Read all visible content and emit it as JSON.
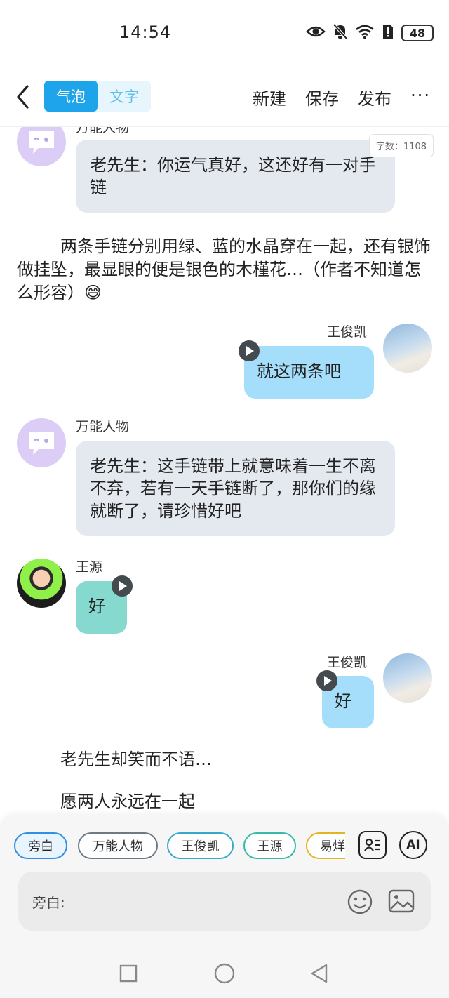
{
  "status": {
    "time": "14:54",
    "battery": "48"
  },
  "nav": {
    "tab_bubble": "气泡",
    "tab_text": "文字",
    "new_label": "新建",
    "save_label": "保存",
    "publish_label": "发布",
    "more": "···"
  },
  "chat": {
    "word_count": "字数：1108",
    "messages": [
      {
        "type": "bubble",
        "speaker": "万能人物",
        "text": "老先生：你运气真好，这还好有一对手链"
      },
      {
        "type": "narration",
        "text": "两条手链分别用绿、蓝的水晶穿在一起，还有银饰做挂坠，最显眼的便是银色的木槿花…（作者不知道怎么形容）😅"
      },
      {
        "type": "bubble",
        "speaker": "王俊凯",
        "text": "就这两条吧"
      },
      {
        "type": "bubble",
        "speaker": "万能人物",
        "text": "老先生：这手链带上就意味着一生不离不弃，若有一天手链断了，那你们的缘就断了，请珍惜好吧"
      },
      {
        "type": "bubble",
        "speaker": "王源",
        "text": "好"
      },
      {
        "type": "bubble",
        "speaker": "王俊凯",
        "text": "好"
      },
      {
        "type": "narration",
        "text": "老先生却笑而不语…"
      },
      {
        "type": "narration",
        "text": "愿两人永远在一起"
      }
    ]
  },
  "roles": [
    {
      "label": "旁白",
      "color": "#2f8fe0",
      "selected": true
    },
    {
      "label": "万能人物",
      "color": "#6c7a86"
    },
    {
      "label": "王俊凯",
      "color": "#35a9c9"
    },
    {
      "label": "王源",
      "color": "#35b9a8"
    },
    {
      "label": "易烊千玺",
      "color": "#e3b520"
    }
  ],
  "tools": {
    "role_manage_icon": "contact-card-icon",
    "ai_label": "AI"
  },
  "input": {
    "label": "旁白:",
    "emoji_icon": "smiley-icon",
    "image_icon": "image-icon"
  }
}
